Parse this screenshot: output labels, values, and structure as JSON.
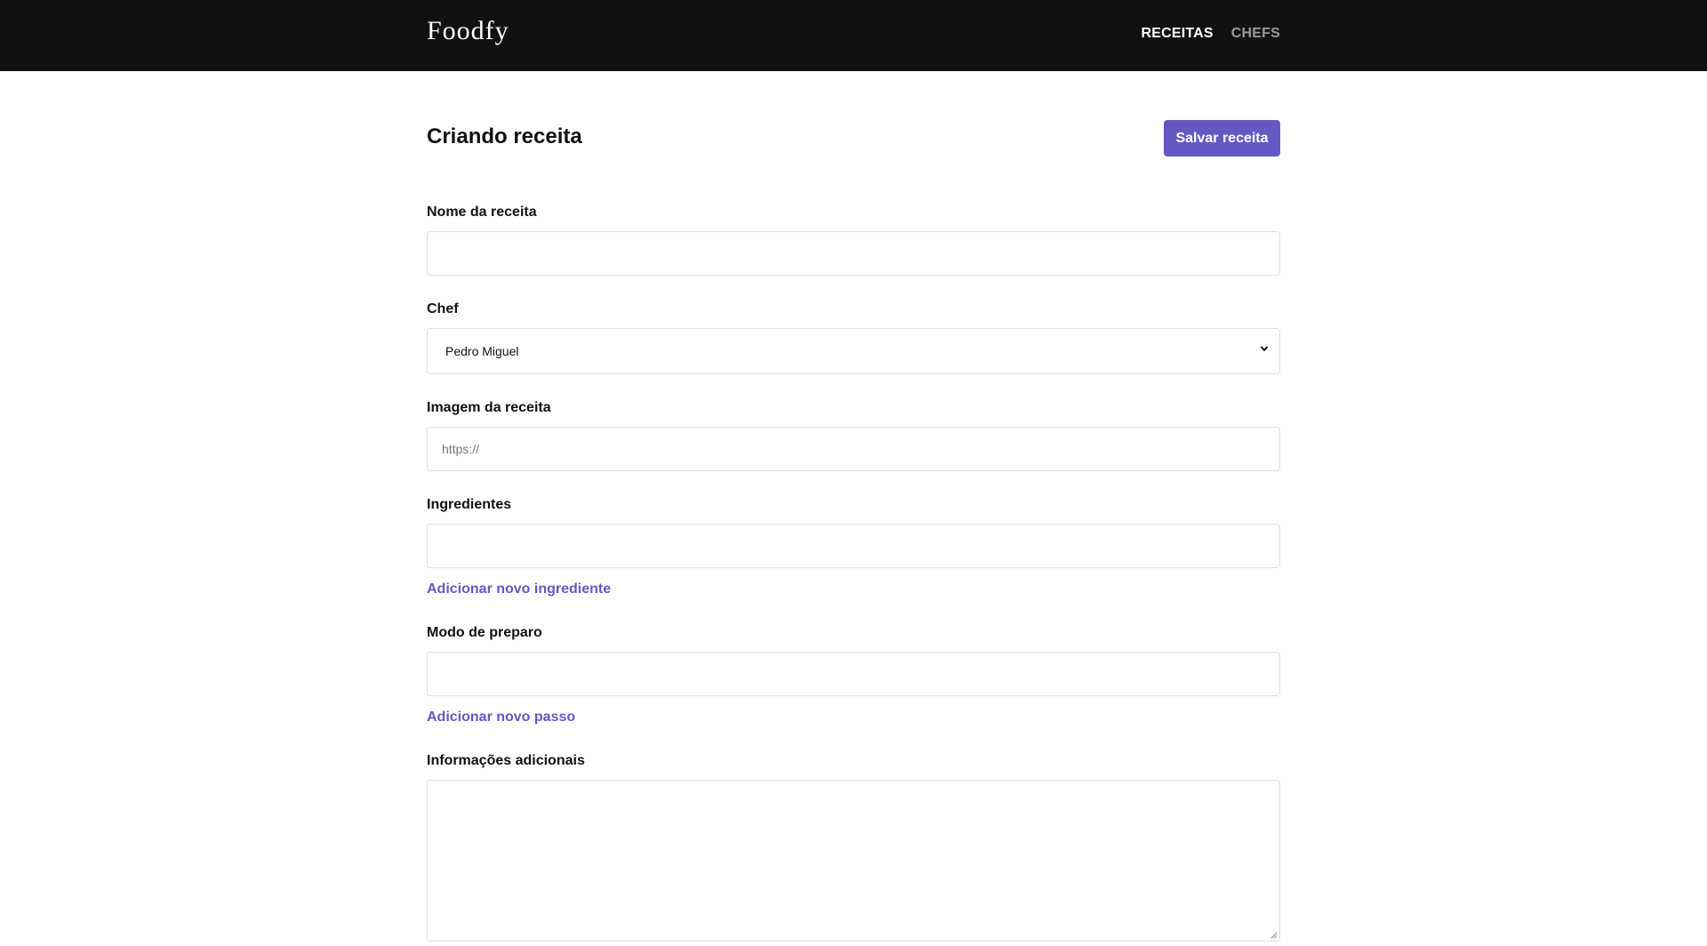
{
  "header": {
    "logo": "Foodfy",
    "nav": [
      {
        "label": "RECEITAS",
        "active": true
      },
      {
        "label": "CHEFS",
        "active": false
      }
    ]
  },
  "page": {
    "title": "Criando receita",
    "save_label": "Salvar receita"
  },
  "form": {
    "recipe_name": {
      "label": "Nome da receita",
      "value": ""
    },
    "chef": {
      "label": "Chef",
      "selected": "Pedro Miguel"
    },
    "image": {
      "label": "Imagem da receita",
      "placeholder": "https://"
    },
    "ingredients": {
      "label": "Ingredientes",
      "value": "",
      "add_label": "Adicionar novo ingrediente"
    },
    "preparation": {
      "label": "Modo de preparo",
      "value": "",
      "add_label": "Adicionar novo passo"
    },
    "additional_info": {
      "label": "Informações adicionais",
      "value": ""
    }
  },
  "colors": {
    "topbar": "#111111",
    "accent": "#6558c3",
    "nav_inactive": "#9a9a9a",
    "border": "#dddddd"
  },
  "icons": {
    "select_arrow": "chevron-down-icon",
    "textarea_grip": "resize-grip-icon"
  }
}
